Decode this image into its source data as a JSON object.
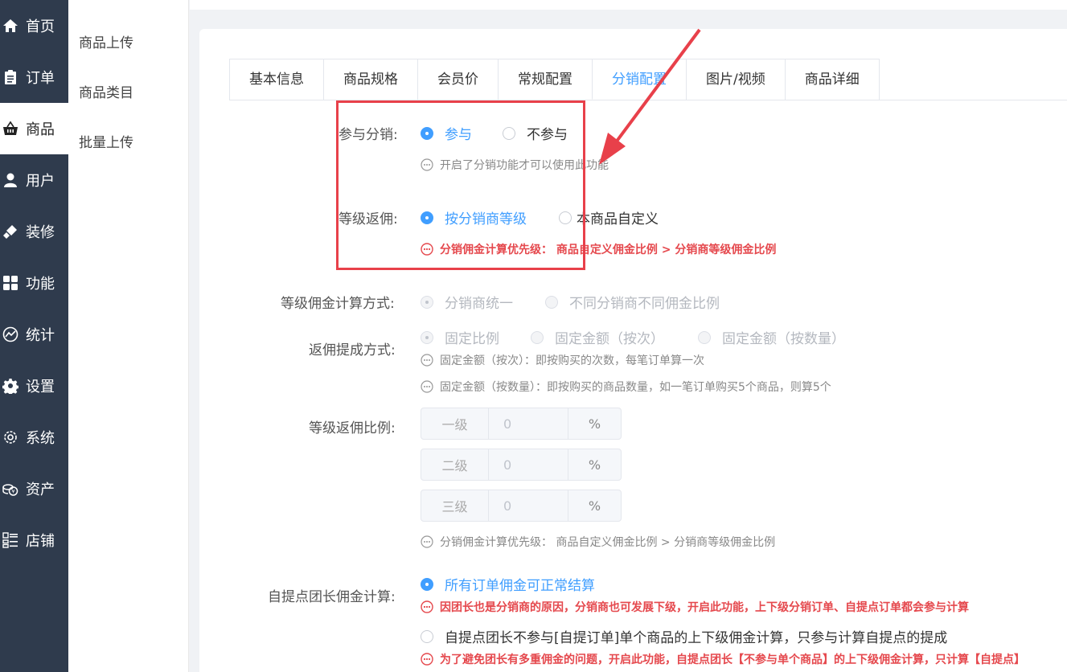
{
  "sidebar": {
    "items": [
      {
        "label": "首页",
        "icon": "home-icon"
      },
      {
        "label": "订单",
        "icon": "clipboard-icon"
      },
      {
        "label": "商品",
        "icon": "shopping-basket-icon",
        "active": true
      },
      {
        "label": "用户",
        "icon": "user-icon"
      },
      {
        "label": "装修",
        "icon": "brush-icon"
      },
      {
        "label": "功能",
        "icon": "grid-icon"
      },
      {
        "label": "统计",
        "icon": "chart-icon"
      },
      {
        "label": "设置",
        "icon": "gear-icon"
      },
      {
        "label": "系统",
        "icon": "cog-outline-icon"
      },
      {
        "label": "资产",
        "icon": "coins-icon"
      },
      {
        "label": "店铺",
        "icon": "store-list-icon"
      }
    ]
  },
  "submenu": {
    "items": [
      "商品上传",
      "商品类目",
      "批量上传"
    ]
  },
  "tabs": [
    "基本信息",
    "商品规格",
    "会员价",
    "常规配置",
    "分销配置",
    "图片/视频",
    "商品详细"
  ],
  "form": {
    "participate": {
      "label": "参与分销:",
      "opt1": "参与",
      "opt2": "不参与",
      "hint": "开启了分销功能才可以使用此功能"
    },
    "level_rebate": {
      "label": "等级返佣:",
      "opt1": "按分销商等级",
      "opt2": "本商品自定义",
      "hint": "分销佣金计算优先级： 商品自定义佣金比例 > 分销商等级佣金比例"
    },
    "calc_mode": {
      "label": "等级佣金计算方式:",
      "opt1": "分销商统一",
      "opt2": "不同分销商不同佣金比例"
    },
    "rebate_mode": {
      "label": "返佣提成方式:",
      "opt1": "固定比例",
      "opt2": "固定金额（按次）",
      "opt3": "固定金额（按数量）",
      "hint1": "固定金额（按次）：即按购买的次数，每笔订单算一次",
      "hint2": "固定金额（按数量）：即按购买的商品数量，如一笔订单购买5个商品，则算5个"
    },
    "ratio": {
      "label": "等级返佣比例:",
      "levels": [
        {
          "name": "一级",
          "value": "0",
          "unit": "%"
        },
        {
          "name": "二级",
          "value": "0",
          "unit": "%"
        },
        {
          "name": "三级",
          "value": "0",
          "unit": "%"
        }
      ],
      "hint": "分销佣金计算优先级： 商品自定义佣金比例 > 分销商等级佣金比例"
    },
    "pickup": {
      "label": "自提点团长佣金计算:",
      "opt1": "所有订单佣金可正常结算",
      "hint1": "因团长也是分销商的原因，分销商也可发展下级，开启此功能，上下级分销订单、自提点订单都会参与计算",
      "opt2": "自提点团长不参与[自提订单]单个商品的上下级佣金计算，只参与计算自提点的提成",
      "hint2": "为了避免团长有多重佣金的问题，开启此功能，自提点团长【不参与单个商品】的上下级佣金计算，只计算【自提点】"
    }
  },
  "colors": {
    "primary": "#409eff",
    "sidebar_bg": "#2f3b4d",
    "highlight_red": "#e8404a"
  }
}
